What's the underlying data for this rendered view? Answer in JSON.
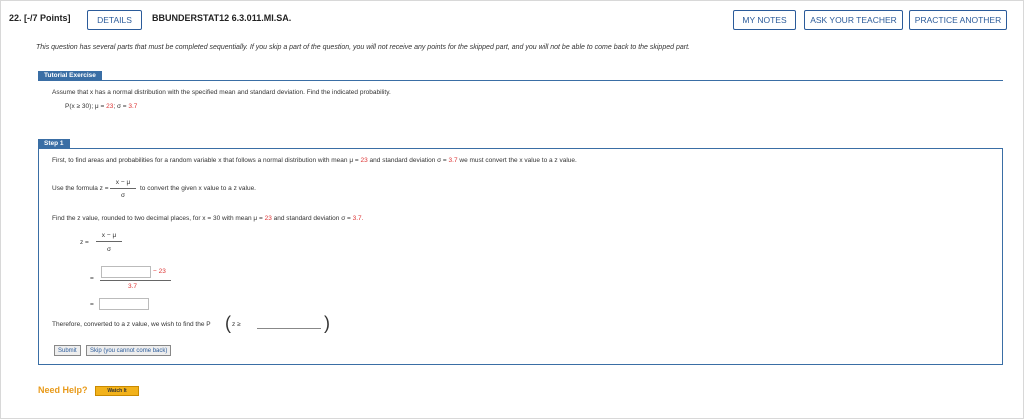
{
  "header": {
    "question_number": "22. [-/7 Points]",
    "details_label": "DETAILS",
    "question_id": "BBUNDERSTAT12 6.3.011.MI.SA.",
    "my_notes_label": "MY NOTES",
    "ask_teacher_label": "ASK YOUR TEACHER",
    "practice_label": "PRACTICE ANOTHER"
  },
  "intro": "This question has several parts that must be completed sequentially. If you skip a part of the question, you will not receive any points for the skipped part, and you will not be able to come back to the skipped part.",
  "tutorial": {
    "header": "Tutorial Exercise",
    "prompt": "Assume that x has a normal distribution with the specified mean and standard deviation. Find the indicated probability.",
    "given_prefix": "P(x ≥ 30); μ = ",
    "mu": "23",
    "sigma_prefix": "; σ = ",
    "sigma": "3.7"
  },
  "step": {
    "header": "Step 1",
    "line1_pre": "First, to find areas and probabilities for a random variable x that follows a normal distribution with mean μ = ",
    "line1_mu": "23",
    "line1_mid": " and standard deviation σ = ",
    "line1_sigma": "3.7",
    "line1_post": " we must convert the x value to a z value.",
    "formula_pre": "Use the formula z = ",
    "formula_num": "x − μ",
    "formula_den": "σ",
    "formula_post": "to convert the given x value to a z value.",
    "find_pre": "Find the z value, rounded to two decimal places, for x = 30 with mean μ = ",
    "find_mu": "23",
    "find_mid": " and standard deviation σ = ",
    "find_sigma": "3.7.",
    "z_label": "z =",
    "eq1": "=",
    "sub_num": "− 23",
    "sub_den": "3.7",
    "eq2": "=",
    "therefore": "Therefore, converted to a z value, we wish to find the P",
    "z_ge": "z ≥",
    "submit_label": "Submit",
    "skip_label": "Skip (you cannot come back)"
  },
  "help": {
    "need_help": "Need Help?",
    "watch_label": "Watch It"
  }
}
